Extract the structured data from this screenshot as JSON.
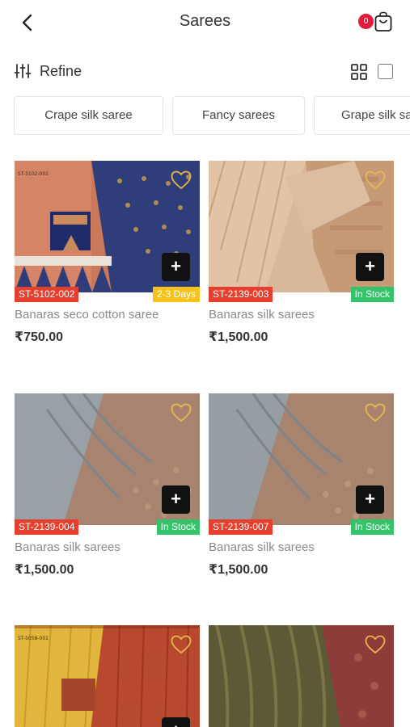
{
  "header": {
    "title": "Sarees",
    "cart_count": "0",
    "back_icon": "chevron-left-icon",
    "cart_icon": "shopping-bag-icon"
  },
  "toolbar": {
    "refine_label": "Refine",
    "refine_icon": "sliders-icon",
    "grid_view_icon": "grid-icon",
    "list_view_icon": "square-icon"
  },
  "categories": [
    {
      "label": "Crape silk saree"
    },
    {
      "label": "Fancy sarees"
    },
    {
      "label": "Grape silk sa"
    }
  ],
  "colors": {
    "accent_red": "#e4402d",
    "badge_red": "#e01b3c",
    "in_stock_green": "#35c36a",
    "days_yellow": "#f5c31c"
  },
  "products": [
    {
      "sku": "ST-5102-002",
      "stock": "2-3 Days",
      "name": "Banaras seco cotton saree",
      "price": "₹750.00"
    },
    {
      "sku": "ST-2139-003",
      "stock": "In Stock",
      "name": "Banaras silk sarees",
      "price": "₹1,500.00"
    },
    {
      "sku": "ST-2139-004",
      "stock": "In Stock",
      "name": "Banaras silk sarees",
      "price": "₹1,500.00"
    },
    {
      "sku": "ST-2139-007",
      "stock": "In Stock",
      "name": "Banaras silk sarees",
      "price": "₹1,500.00"
    },
    {
      "sku": "",
      "stock": "",
      "name": "",
      "price": ""
    },
    {
      "sku": "",
      "stock": "",
      "name": "",
      "price": ""
    }
  ]
}
